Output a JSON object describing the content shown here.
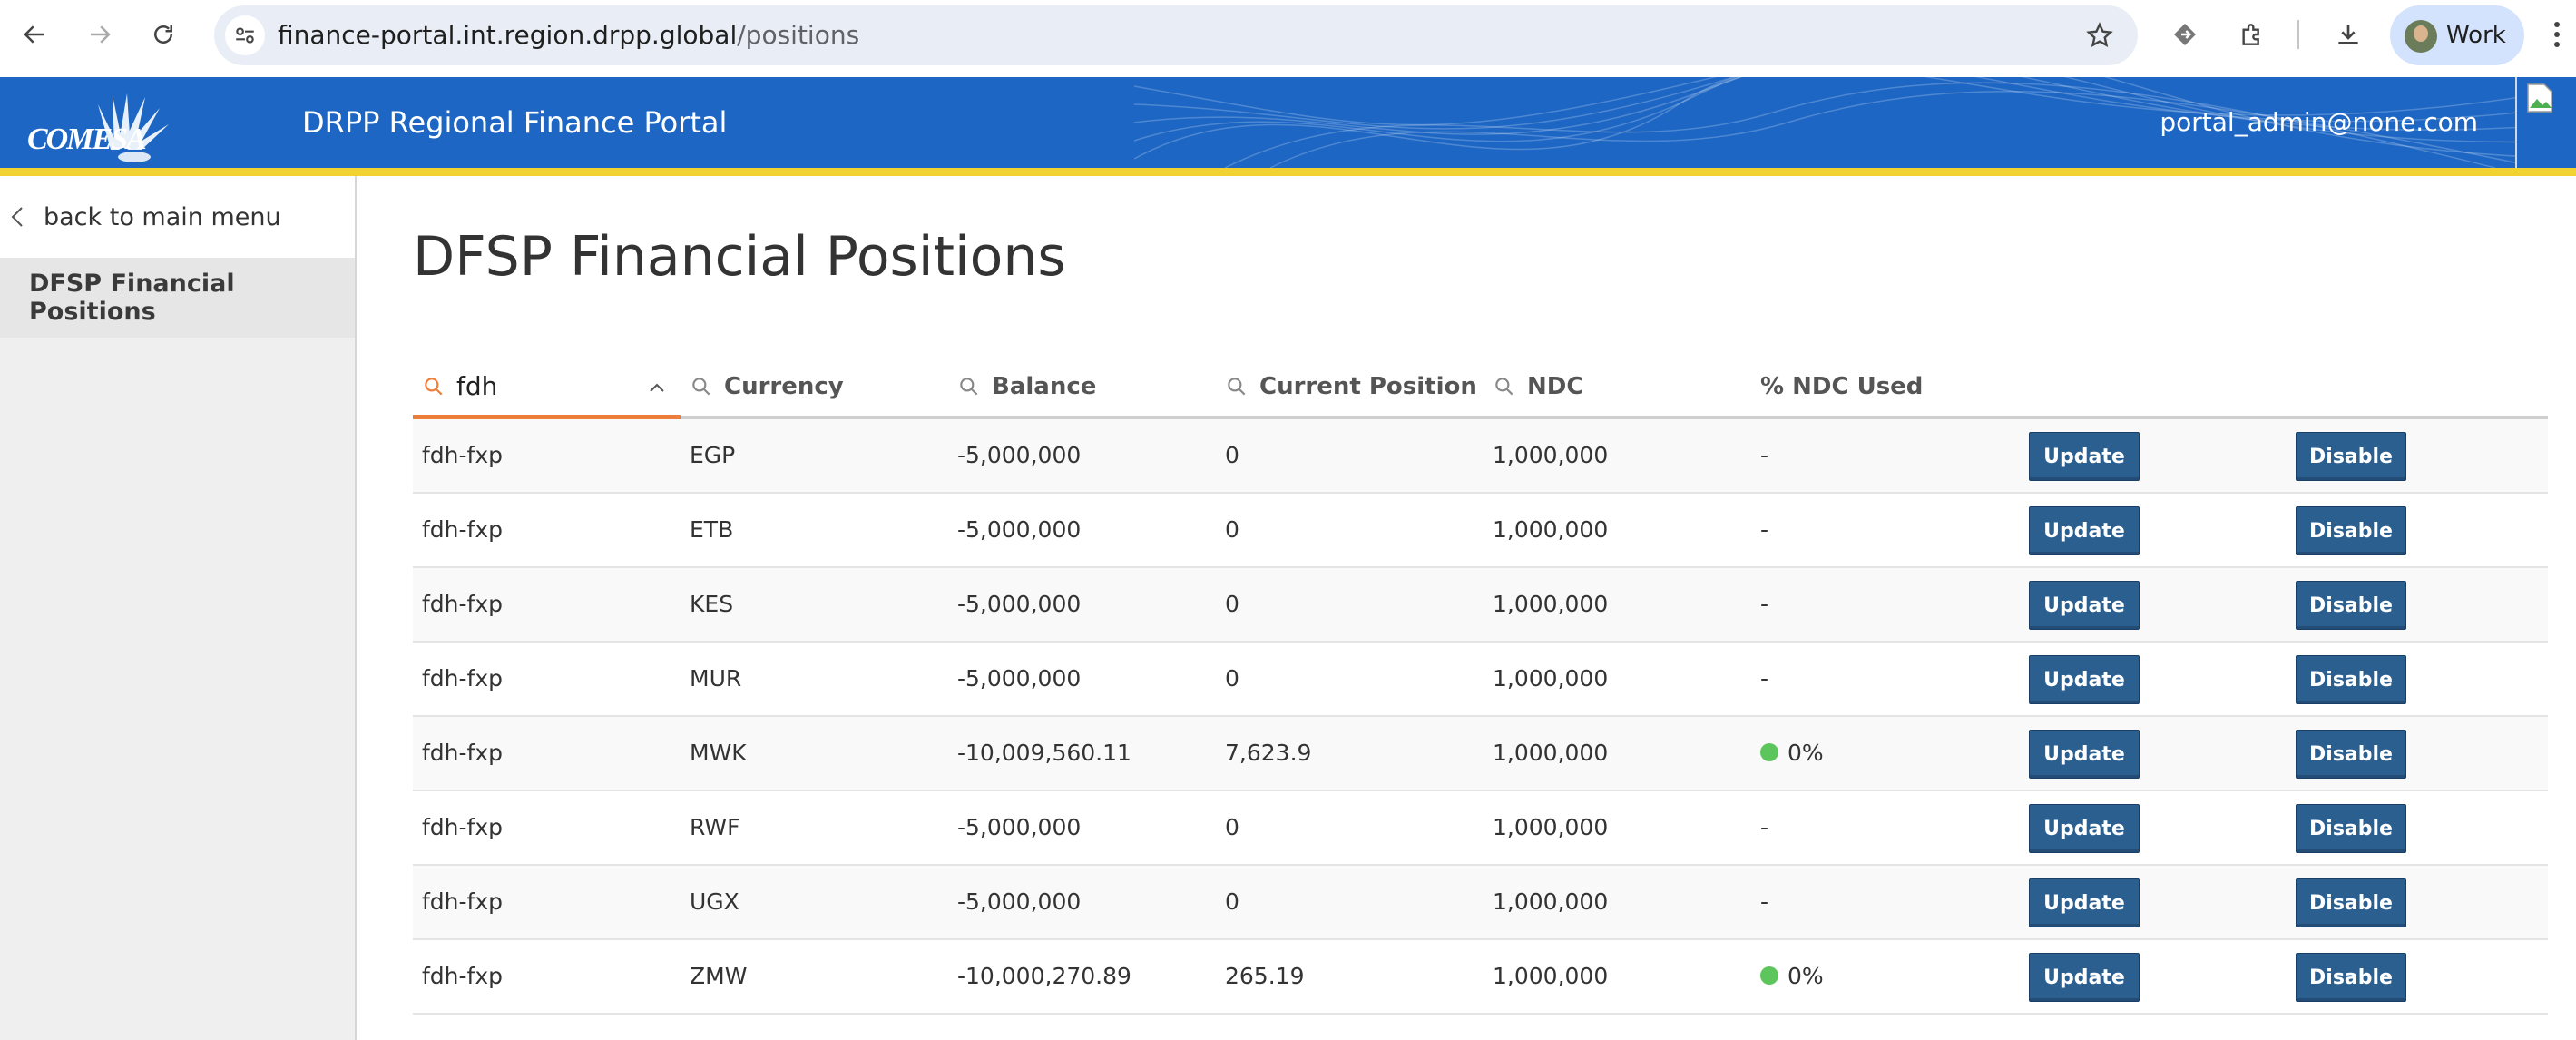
{
  "browser": {
    "url_host": "finance-portal.int.region.drpp.global",
    "url_path": "/positions",
    "profile_name": "Work"
  },
  "header": {
    "logo_text": "COMESA",
    "title": "DRPP Regional Finance Portal",
    "user": "portal_admin@none.com"
  },
  "sidebar": {
    "back_label": "back to main menu",
    "items": [
      {
        "label": "DFSP Financial Positions",
        "selected": true
      }
    ]
  },
  "main": {
    "title": "DFSP Financial Positions"
  },
  "table": {
    "columns": [
      {
        "label": "fdh",
        "filter_active": true
      },
      {
        "label": "Currency"
      },
      {
        "label": "Balance"
      },
      {
        "label": "Current Position"
      },
      {
        "label": "NDC"
      },
      {
        "label": "% NDC Used"
      }
    ],
    "update_label": "Update",
    "disable_label": "Disable",
    "rows": [
      {
        "dfsp": "fdh-fxp",
        "currency": "EGP",
        "balance": "-5,000,000",
        "position": "0",
        "ndc": "1,000,000",
        "ndc_used": "-",
        "status_dot": false
      },
      {
        "dfsp": "fdh-fxp",
        "currency": "ETB",
        "balance": "-5,000,000",
        "position": "0",
        "ndc": "1,000,000",
        "ndc_used": "-",
        "status_dot": false
      },
      {
        "dfsp": "fdh-fxp",
        "currency": "KES",
        "balance": "-5,000,000",
        "position": "0",
        "ndc": "1,000,000",
        "ndc_used": "-",
        "status_dot": false
      },
      {
        "dfsp": "fdh-fxp",
        "currency": "MUR",
        "balance": "-5,000,000",
        "position": "0",
        "ndc": "1,000,000",
        "ndc_used": "-",
        "status_dot": false
      },
      {
        "dfsp": "fdh-fxp",
        "currency": "MWK",
        "balance": "-10,009,560.11",
        "position": "7,623.9",
        "ndc": "1,000,000",
        "ndc_used": "0%",
        "status_dot": true
      },
      {
        "dfsp": "fdh-fxp",
        "currency": "RWF",
        "balance": "-5,000,000",
        "position": "0",
        "ndc": "1,000,000",
        "ndc_used": "-",
        "status_dot": false
      },
      {
        "dfsp": "fdh-fxp",
        "currency": "UGX",
        "balance": "-5,000,000",
        "position": "0",
        "ndc": "1,000,000",
        "ndc_used": "-",
        "status_dot": false
      },
      {
        "dfsp": "fdh-fxp",
        "currency": "ZMW",
        "balance": "-10,000,270.89",
        "position": "265.19",
        "ndc": "1,000,000",
        "ndc_used": "0%",
        "status_dot": true
      }
    ]
  },
  "colors": {
    "header_blue": "#1d66c4",
    "header_stripe": "#f2d230",
    "button_blue": "#2b5f90",
    "active_filter": "#ef7d3a",
    "status_green": "#5cc65c"
  }
}
